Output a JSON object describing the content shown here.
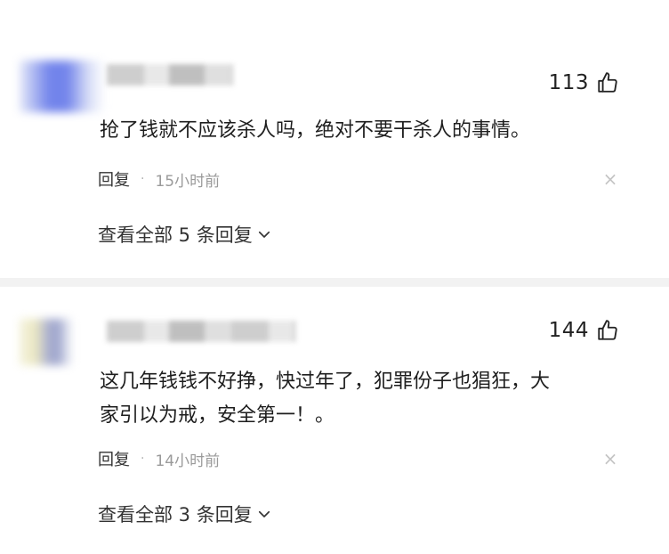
{
  "comments": [
    {
      "likes": "113",
      "text": "抢了钱就不应该杀人吗，绝对不要干杀人的事情。",
      "reply_label": "回复",
      "separator": "·",
      "time": "15小时前",
      "close_symbol": "×",
      "view_replies": "查看全部 5 条回复"
    },
    {
      "likes": "144",
      "text": "这几年钱钱不好挣，快过年了，犯罪份子也猖狂，大\n家引以为戒，安全第一！。",
      "reply_label": "回复",
      "separator": "·",
      "time": "14小时前",
      "close_symbol": "×",
      "view_replies": "查看全部 3 条回复"
    }
  ],
  "icons": {
    "like": "thumbs-up-icon",
    "close": "close-icon",
    "expand": "chevron-down-icon"
  }
}
